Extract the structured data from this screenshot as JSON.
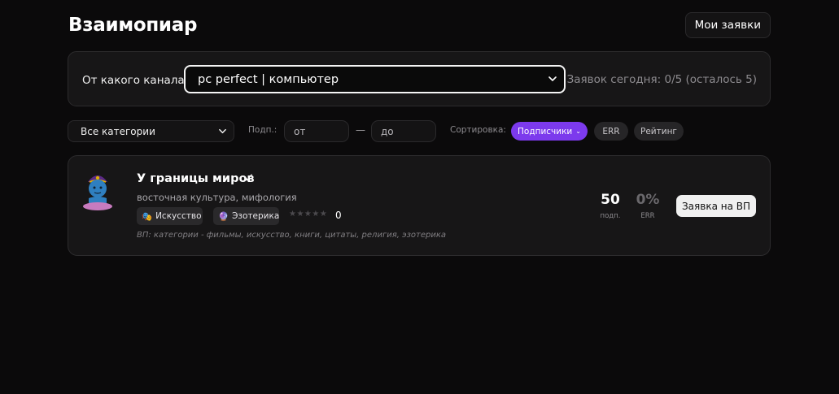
{
  "header": {
    "title": "Взаимопиар",
    "my_requests_label": "Мои заявки"
  },
  "channel_picker": {
    "label": "От какого канала:",
    "selected": "pc perfect | компьютер",
    "requests_today": "Заявок сегодня: 0/5 (осталось 5)"
  },
  "filters": {
    "category_selected": "Все категории",
    "subscribers_label": "Подп.:",
    "from_placeholder": "от",
    "dash": "—",
    "to_placeholder": "до",
    "sort_label": "Сортировка:",
    "sort_options": [
      {
        "label": "Подписчики",
        "active": true
      },
      {
        "label": "ERR",
        "active": false
      },
      {
        "label": "Рейтинг",
        "active": false
      }
    ],
    "accent_color": "#7c3aed"
  },
  "results": [
    {
      "avatar_icon": "genie-emoji-icon",
      "name": "У границы миров",
      "verified_mark": "✓",
      "description": "восточная культура, мифология",
      "tags": [
        {
          "icon": "🎭",
          "label": "Искусство"
        },
        {
          "icon": "🔮",
          "label": "Эзотерика"
        }
      ],
      "stars": "★★★★★",
      "rating_value": "0",
      "stars_filled": 0,
      "vp_note": "ВП: категории - фильмы, искусство, книги, цитаты, религия, эзотерика",
      "subscribers": "50",
      "subscribers_label": "подп.",
      "err": "0%",
      "err_label": "ERR",
      "apply_label": "Заявка на ВП"
    }
  ]
}
